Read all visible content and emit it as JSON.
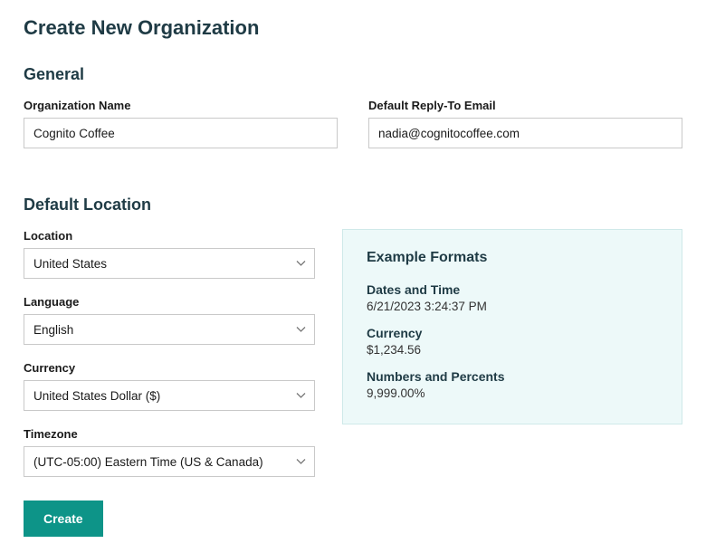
{
  "page_title": "Create New Organization",
  "sections": {
    "general": {
      "heading": "General",
      "org_name_label": "Organization Name",
      "org_name_value": "Cognito Coffee",
      "reply_to_label": "Default Reply-To Email",
      "reply_to_value": "nadia@cognitocoffee.com"
    },
    "default_location": {
      "heading": "Default Location",
      "location_label": "Location",
      "location_value": "United States",
      "language_label": "Language",
      "language_value": "English",
      "currency_label": "Currency",
      "currency_value": "United States Dollar ($)",
      "timezone_label": "Timezone",
      "timezone_value": "(UTC-05:00) Eastern Time (US & Canada)"
    },
    "example_formats": {
      "heading": "Example Formats",
      "dates_label": "Dates and Time",
      "dates_value": "6/21/2023 3:24:37 PM",
      "currency_label": "Currency",
      "currency_value": "$1,234.56",
      "numbers_label": "Numbers and Percents",
      "numbers_value": "9,999.00%"
    }
  },
  "buttons": {
    "create": "Create"
  }
}
